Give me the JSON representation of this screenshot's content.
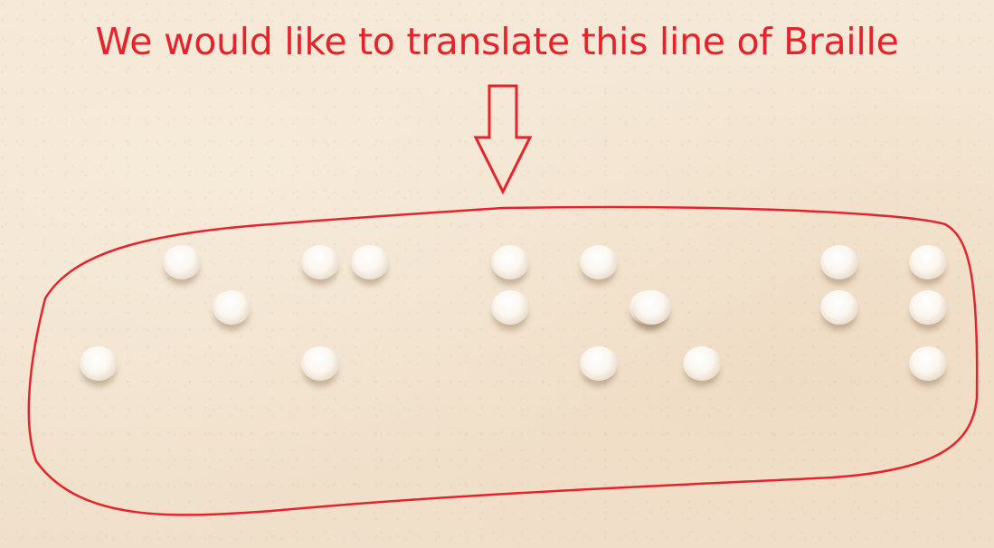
{
  "caption": "We would like to translate this line of Braille",
  "colors": {
    "annotation": "#e8222a",
    "paper": "#f3e5d2",
    "dot": "#fbf6ef"
  },
  "braille": {
    "cells": [
      {
        "dots": [
          3
        ]
      },
      {
        "dots": [
          1,
          5
        ]
      },
      {
        "dots": [
          1,
          3,
          4
        ]
      },
      {
        "dots": [
          4,
          5
        ]
      },
      {
        "dots": [
          1,
          3,
          5
        ]
      },
      {
        "dots": [
          2,
          6
        ]
      },
      {
        "dots": [
          4,
          5
        ]
      },
      {
        "dots": [
          4,
          5,
          6
        ]
      }
    ]
  }
}
